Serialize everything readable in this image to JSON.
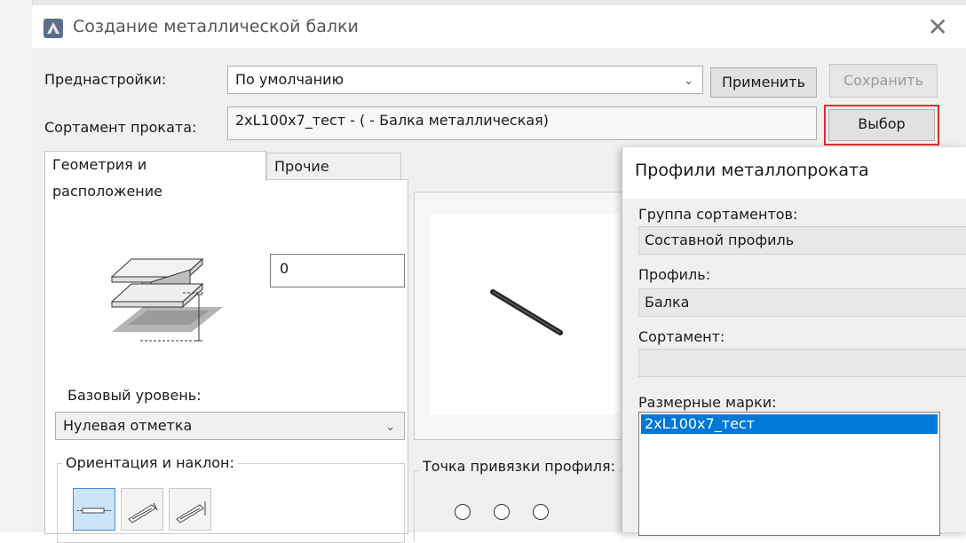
{
  "window": {
    "title": "Создание металлической балки",
    "close_glyph": "✕"
  },
  "presets": {
    "label": "Преднастройки:",
    "value": "По умолчанию",
    "apply_label": "Применить",
    "save_label": "Сохранить"
  },
  "assortment": {
    "label": "Сортамент проката:",
    "value": "2xL100x7_тест - ( - Балка металлическая)",
    "select_label": "Выбор"
  },
  "tabs": [
    {
      "label": "Геометрия и расположение",
      "active": true
    },
    {
      "label": "Прочие свойства",
      "active": false
    }
  ],
  "geometry": {
    "offset_value": "0",
    "base_level_label": "Базовый уровень:",
    "base_level_value": "Нулевая отметка",
    "orientation_label": "Ориентация и наклон:",
    "anchor_label": "Точка привязки профиля:"
  },
  "profiles_popup": {
    "title": "Профили металлопроката",
    "group_label": "Группа сортаментов:",
    "group_value": "Составной профиль",
    "profile_label": "Профиль:",
    "profile_value": "Балка",
    "assortment_label": "Сортамент:",
    "assortment_value": "",
    "marks_label": "Размерные марки:",
    "marks": [
      "2xL100x7_тест"
    ]
  },
  "colors": {
    "highlight": "#d9302c",
    "selection": "#0078d7"
  }
}
